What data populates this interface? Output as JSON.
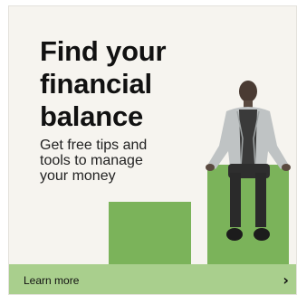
{
  "ad": {
    "headline_lines": [
      "Find your",
      "financial",
      "balance"
    ],
    "subtext_lines": [
      "Get free tips and",
      "tools to manage",
      "your money"
    ],
    "cta_label": "Learn more",
    "cta_icon": "chevron-right-icon",
    "colors": {
      "background": "#f6f4ef",
      "bar_green": "#7bb35a",
      "footer_green": "#a9cf8d",
      "text": "#111111"
    }
  }
}
